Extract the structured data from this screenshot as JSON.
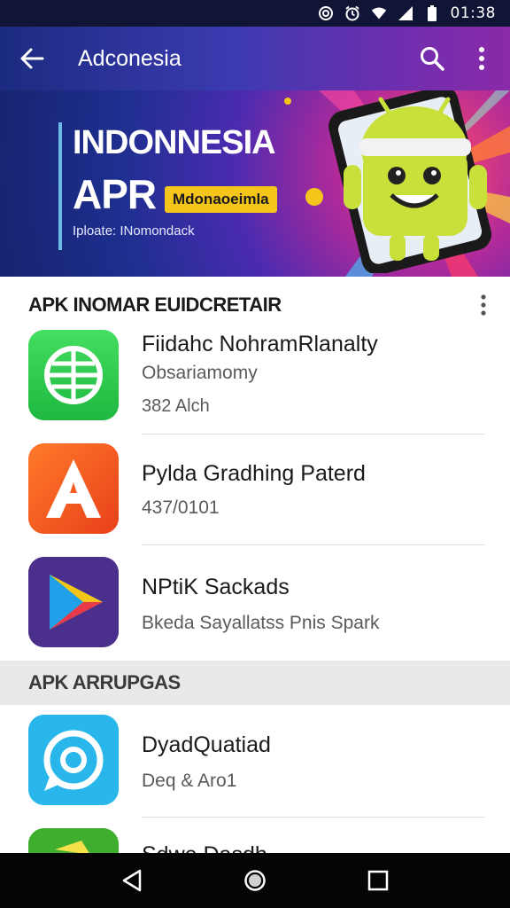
{
  "status_bar": {
    "time": "01:38",
    "icons": [
      "at-icon",
      "alarm-icon",
      "wifi-icon",
      "signal-icon",
      "battery-icon"
    ]
  },
  "app_bar": {
    "title": "Adconesia",
    "back_icon": "arrow-left-icon",
    "actions": [
      "search-icon",
      "more-vert-icon"
    ]
  },
  "banner": {
    "headline_1": "INDONNESIA",
    "headline_2": "APR",
    "badge": "Mdonaoeimla",
    "subline": "Iploate: INomondack"
  },
  "section_1": {
    "title": "APK INOMAR EUIDCRETAIR",
    "items": [
      {
        "name": "Fiidahc NohramRlanalty",
        "sub": "Obsariamomy",
        "meta": "382 Alch",
        "icon": "globe-icon",
        "color": "#2ccf4e"
      },
      {
        "name": "Pylda Gradhing Paterd",
        "sub": "437/0101",
        "meta": "",
        "icon": "letter-a-icon",
        "color": "#f4641e"
      },
      {
        "name": "NPtiK Sackads",
        "sub": "Bkeda Sayallatss Pnis Spark",
        "meta": "",
        "icon": "play-triangle-icon",
        "color": "#4a2f8c"
      }
    ]
  },
  "section_2": {
    "title": "APK ARRUPGAS",
    "items": [
      {
        "name": "DyadQuatiad",
        "sub": "Deq & Aro1",
        "icon": "chat-target-icon",
        "color": "#29b6ea"
      },
      {
        "name": "Sdwe Dasdh",
        "sub": "",
        "icon": "folder-icon",
        "color": "#3fae2e"
      }
    ]
  },
  "nav_bar": {
    "buttons": [
      "back-triangle-icon",
      "home-circle-icon",
      "recents-square-icon"
    ]
  },
  "colors": {
    "accent_green": "#2ccf4e",
    "badge_yellow": "#f6c51a",
    "app_bar_start": "#1b2b80",
    "app_bar_end": "#8a2aa8"
  }
}
